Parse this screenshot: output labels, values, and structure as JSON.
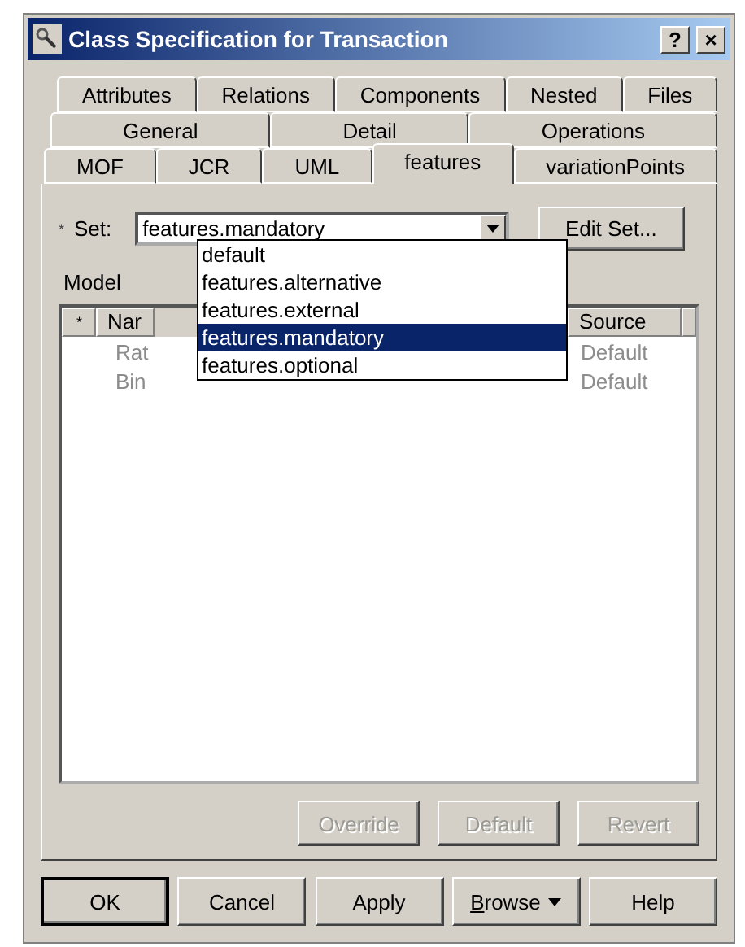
{
  "window": {
    "title": "Class Specification for Transaction",
    "help": "?",
    "close": "×"
  },
  "tab_rows": [
    [
      {
        "label": "Attributes",
        "selected": false
      },
      {
        "label": "Relations",
        "selected": false
      },
      {
        "label": "Components",
        "selected": false
      },
      {
        "label": "Nested",
        "selected": false
      },
      {
        "label": "Files",
        "selected": false
      }
    ],
    [
      {
        "label": "General",
        "selected": false
      },
      {
        "label": "Detail",
        "selected": false
      },
      {
        "label": "Operations",
        "selected": false
      }
    ],
    [
      {
        "label": "MOF",
        "selected": false
      },
      {
        "label": "JCR",
        "selected": false
      },
      {
        "label": "UML",
        "selected": false
      },
      {
        "label": "features",
        "selected": true
      },
      {
        "label": "variationPoints",
        "selected": false
      }
    ]
  ],
  "set": {
    "marker": "*",
    "label": "Set:",
    "value": "features.mandatory",
    "expanded": true,
    "options": [
      {
        "label": "default",
        "selected": false
      },
      {
        "label": "features.alternative",
        "selected": false
      },
      {
        "label": "features.external",
        "selected": false
      },
      {
        "label": "features.mandatory",
        "selected": true
      },
      {
        "label": "features.optional",
        "selected": false
      }
    ],
    "edit_button": "Edit Set..."
  },
  "model_label": "Model",
  "table": {
    "columns": [
      "*",
      "Nar",
      "Source"
    ],
    "rows": [
      {
        "name": "Rat",
        "source": "Default"
      },
      {
        "name": "Bin",
        "source": "Default"
      }
    ]
  },
  "action_buttons": [
    {
      "label": "Override",
      "disabled": true
    },
    {
      "label": "Default",
      "disabled": true
    },
    {
      "label": "Revert",
      "disabled": true
    }
  ],
  "dialog_buttons": [
    {
      "label": "OK",
      "default": true,
      "menu": false,
      "underline_first": false
    },
    {
      "label": "Cancel",
      "default": false,
      "menu": false,
      "underline_first": false
    },
    {
      "label": "Apply",
      "default": false,
      "menu": false,
      "underline_first": false
    },
    {
      "label": "Browse",
      "default": false,
      "menu": true,
      "underline_first": true
    },
    {
      "label": "Help",
      "default": false,
      "menu": false,
      "underline_first": false
    }
  ]
}
